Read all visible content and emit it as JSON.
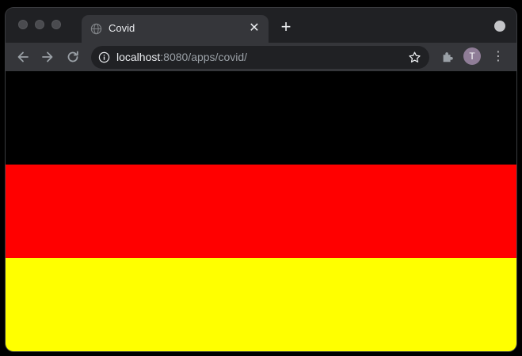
{
  "window": {
    "tab": {
      "title": "Covid"
    },
    "address_bar": {
      "host": "localhost",
      "rest": ":8080/apps/covid/"
    },
    "profile_initial": "T"
  },
  "page": {
    "flag_stripes": [
      {
        "name": "black",
        "color": "#000000"
      },
      {
        "name": "red",
        "color": "#ff0000"
      },
      {
        "name": "yellow",
        "color": "#ffff00"
      }
    ]
  }
}
